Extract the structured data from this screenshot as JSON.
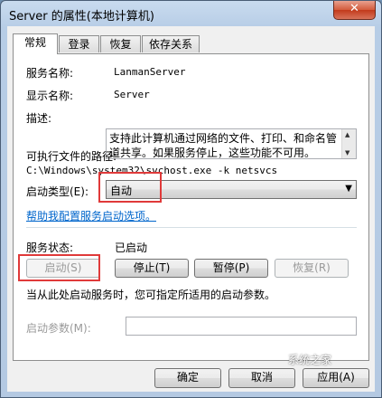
{
  "window": {
    "title": "Server 的属性(本地计算机)",
    "close_glyph": "✕"
  },
  "tabs": [
    {
      "label": "常规",
      "active": true
    },
    {
      "label": "登录",
      "active": false
    },
    {
      "label": "恢复",
      "active": false
    },
    {
      "label": "依存关系",
      "active": false
    }
  ],
  "general": {
    "service_name_label": "服务名称:",
    "service_name_value": "LanmanServer",
    "display_name_label": "显示名称:",
    "display_name_value": "Server",
    "description_label": "描述:",
    "description_value": "支持此计算机通过网络的文件、打印、和命名管道共享。如果服务停止，这些功能不可用。",
    "path_label": "可执行文件的路径:",
    "path_value": "C:\\Windows\\system32\\svchost.exe -k netsvcs",
    "startup_type_label": "启动类型(E):",
    "startup_type_value": "自动",
    "help_link": "帮助我配置服务启动选项。",
    "status_label": "服务状态:",
    "status_value": "已启动",
    "start_button": "启动(S)",
    "stop_button": "停止(T)",
    "pause_button": "暂停(P)",
    "resume_button": "恢复(R)",
    "hint_text": "当从此处启动服务时，您可指定所适用的启动参数。",
    "start_params_label": "启动参数(M):",
    "start_params_value": ""
  },
  "footer": {
    "ok_button": "确定",
    "cancel_button": "取消",
    "apply_button": "应用(A)"
  },
  "watermark": "系统之家",
  "colors": {
    "highlight": "#e03a3a",
    "link": "#0066cc"
  }
}
